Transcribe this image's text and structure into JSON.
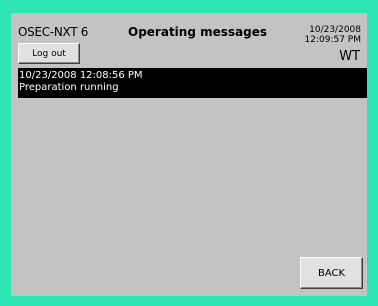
{
  "header": {
    "device": "OSEC-NXT 6",
    "title": "Operating messages",
    "date": "10/23/2008",
    "time": "12:09:57 PM",
    "user": "WT"
  },
  "buttons": {
    "logout": "Log out",
    "back": "BACK"
  },
  "messages": [
    {
      "timestamp": "10/23/2008 12:08:56 PM",
      "text": "Preparation running"
    }
  ]
}
